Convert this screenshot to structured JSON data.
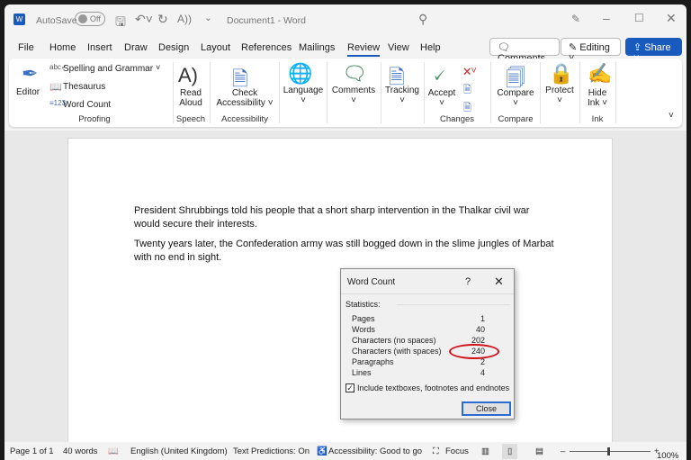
{
  "titlebar": {
    "autosave": "AutoSave",
    "toggle": "Off",
    "doc_title": "Document1  -  Word"
  },
  "tabs": [
    "File",
    "Home",
    "Insert",
    "Draw",
    "Design",
    "Layout",
    "References",
    "Mailings",
    "Review",
    "View",
    "Help"
  ],
  "active_tab": "Review",
  "header_buttons": {
    "comments": "Comments",
    "editing": "Editing",
    "share": "Share"
  },
  "ribbon": {
    "editor": "Editor",
    "spelling": "Spelling and Grammar",
    "thesaurus": "Thesaurus",
    "word_count": "Word Count",
    "proofing": "Proofing",
    "read": "Read",
    "aloud": "Aloud",
    "speech": "Speech",
    "check": "Check",
    "accessibility_btn": "Accessibility",
    "accessibility": "Accessibility",
    "language": "Language",
    "comments": "Comments",
    "tracking": "Tracking",
    "accept": "Accept",
    "changes": "Changes",
    "compare_btn": "Compare",
    "compare": "Compare",
    "protect": "Protect",
    "hide": "Hide",
    "ink_btn": "Ink",
    "ink": "Ink"
  },
  "document": {
    "paragraphs": [
      "President Shrubbings told his people that a short sharp intervention in the Thalkar civil war would secure their interests.",
      "Twenty years later, the Confederation army was still bogged down in the slime jungles of Marbat with no end in sight."
    ]
  },
  "dialog": {
    "title": "Word Count",
    "help": "?",
    "statistics": "Statistics:",
    "rows": [
      {
        "label": "Pages",
        "value": "1"
      },
      {
        "label": "Words",
        "value": "40"
      },
      {
        "label": "Characters (no spaces)",
        "value": "202"
      },
      {
        "label": "Characters (with spaces)",
        "value": "240"
      },
      {
        "label": "Paragraphs",
        "value": "2"
      },
      {
        "label": "Lines",
        "value": "4"
      }
    ],
    "checkbox": "Include textboxes, footnotes and endnotes",
    "checked": true,
    "close": "Close",
    "highlight_color": "#d0121b"
  },
  "status": {
    "page": "Page 1 of 1",
    "words": "40 words",
    "language": "English (United Kingdom)",
    "predictions": "Text Predictions: On",
    "accessibility": "Accessibility: Good to go",
    "focus": "Focus",
    "zoom": "100%"
  },
  "colors": {
    "accent": "#185abd"
  }
}
